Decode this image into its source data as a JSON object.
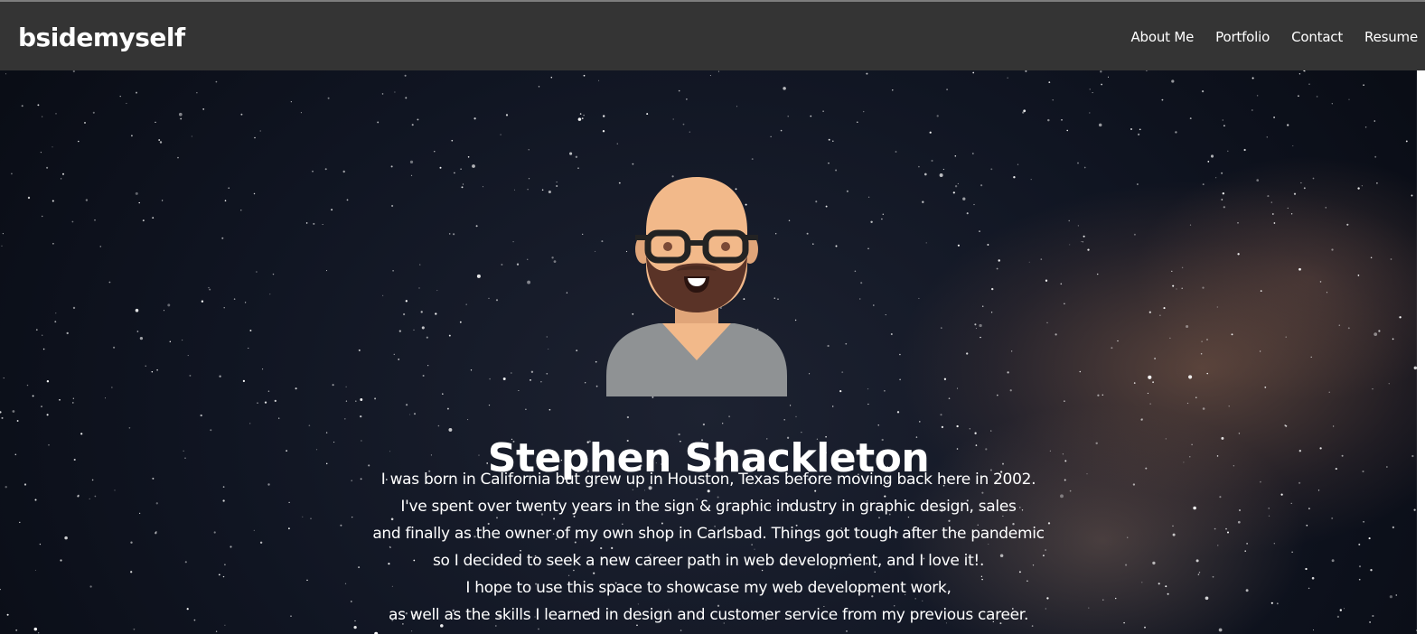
{
  "site": {
    "brand": "bsidemyself"
  },
  "nav": {
    "items": [
      {
        "label": "About Me"
      },
      {
        "label": "Portfolio"
      },
      {
        "label": "Contact"
      },
      {
        "label": "Resume"
      }
    ]
  },
  "hero": {
    "name": "Stephen Shackleton",
    "bio_lines": [
      "I was born in California but grew up in Houston, Texas before moving back here in 2002.",
      "I've spent over twenty years in the sign & graphic industry in graphic design, sales",
      "and finally as the owner of my own shop in Carlsbad. Things got tough after the pandemic",
      "so I decided to seek a new career path in web development, and I love it!.",
      "I hope to use this space to showcase my web development work,",
      "as well as the skills I learned in design and customer service from my previous career."
    ]
  },
  "colors": {
    "navbar": "#343434",
    "text": "#ffffff",
    "sky": "#101522",
    "skin": "#F2B98A",
    "beard": "#5A3327",
    "shirt": "#8F9294",
    "glasses": "#232323"
  },
  "icons": {
    "avatar": "bald-bearded-man-with-glasses-avatar"
  }
}
